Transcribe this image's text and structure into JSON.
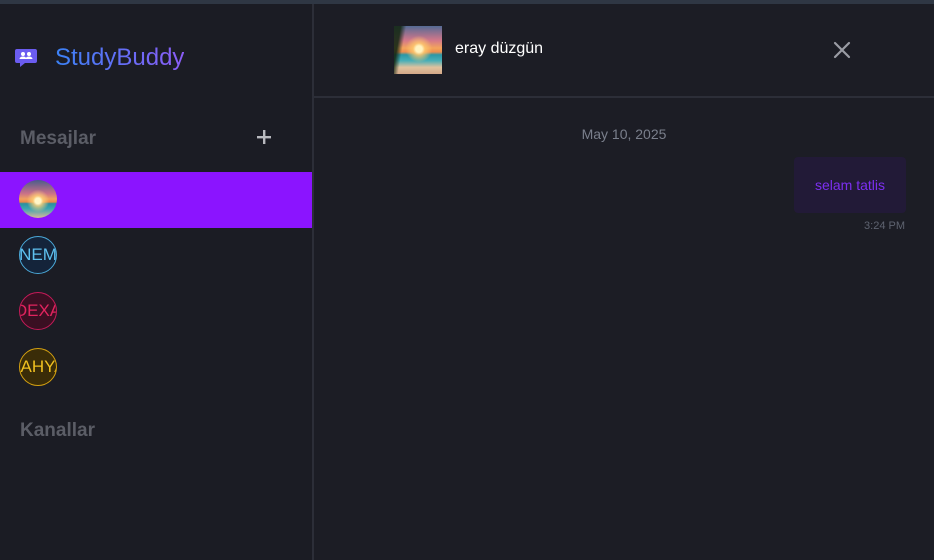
{
  "app": {
    "name": "StudyBuddy"
  },
  "sidebar": {
    "messages_heading": "Mesajlar",
    "channels_heading": "Kanallar",
    "add_label": "+",
    "contacts": [
      {
        "avatar_text": "",
        "avatar": "sunset-photo",
        "active": true
      },
      {
        "avatar_text": "NEM",
        "active": false
      },
      {
        "avatar_text": "DEXA",
        "active": false
      },
      {
        "avatar_text": "YAHYA",
        "active": false
      }
    ]
  },
  "chat": {
    "contact_name": "eray düzgün",
    "date_separator": "May 10, 2025",
    "messages": [
      {
        "text": "selam tatlis",
        "time": "3:24 PM",
        "outgoing": true
      }
    ]
  },
  "colors": {
    "background": "#1c1d25",
    "active_contact": "#8b14ff",
    "brand_gradient_start": "#3b82f6",
    "brand_gradient_end": "#8b5cf6",
    "bubble_text": "#7c2ff0"
  },
  "icons": {
    "brand": "chat-bubble-users-icon",
    "add": "plus-icon",
    "close": "close-icon"
  }
}
